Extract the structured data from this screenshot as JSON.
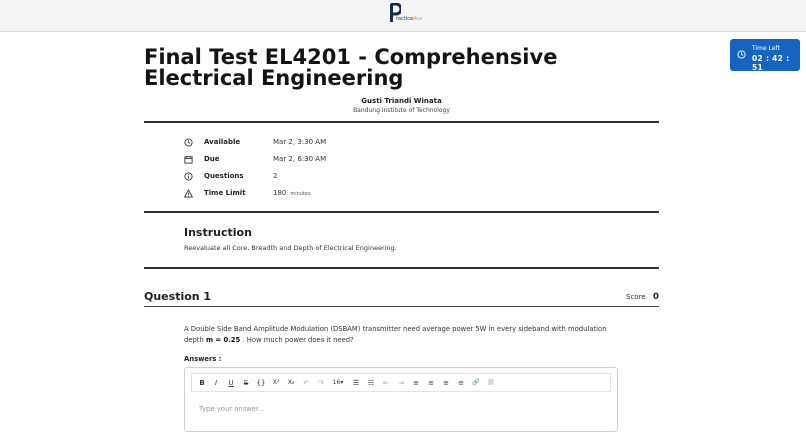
{
  "brand": {
    "logo_letter": "P",
    "logo_text_a": "ractice",
    "logo_text_b": "Ace"
  },
  "timer": {
    "label": "Time Left",
    "value": "02 : 42 : 51"
  },
  "exam": {
    "title": "Final Test EL4201 - Comprehensive Electrical Engineering",
    "author": "Gusti Triandi Winata",
    "institution": "Bandung Institute of Technology"
  },
  "meta": {
    "available": {
      "key": "Available",
      "value": "Mar 2, 3:30 AM",
      "icon": "clock-icon"
    },
    "due": {
      "key": "Due",
      "value": "Mar 2, 6:30 AM",
      "icon": "calendar-icon"
    },
    "questions": {
      "key": "Questions",
      "value": "2",
      "icon": "info-icon"
    },
    "time_limit": {
      "key": "Time Limit",
      "value": "180",
      "unit": "minutes",
      "icon": "warning-icon"
    }
  },
  "instruction": {
    "title": "Instruction",
    "text": "Reevaluate all Core, Breadth and Depth of Electrical Engineering."
  },
  "question": {
    "title": "Question 1",
    "score_label": "Score",
    "score_value": "0",
    "text_part1": "A Double Side Band Amplitude Modulation (DSBAM) transmitter need average power 5W in every sideband with modulation depth",
    "text_bold": "m = 0.25",
    "text_part2": ". How much power does it need?",
    "answers_label": "Answers :",
    "answer_placeholder": "Type your answer..."
  },
  "toolbar": {
    "bold": "B",
    "italic": "I",
    "underline": "U",
    "strike": "S",
    "code": "{}",
    "superscript": "X²",
    "subscript": "X₂",
    "undo": "↶",
    "redo": "↷",
    "font_size": "16",
    "bullet_list": "☰",
    "ordered_list": "☷",
    "outdent": "⇤",
    "indent": "⇥",
    "align_left": "≡",
    "align_center": "≡",
    "align_right": "≡",
    "justify": "≡",
    "link": "🔗",
    "unlink": "⛓"
  }
}
